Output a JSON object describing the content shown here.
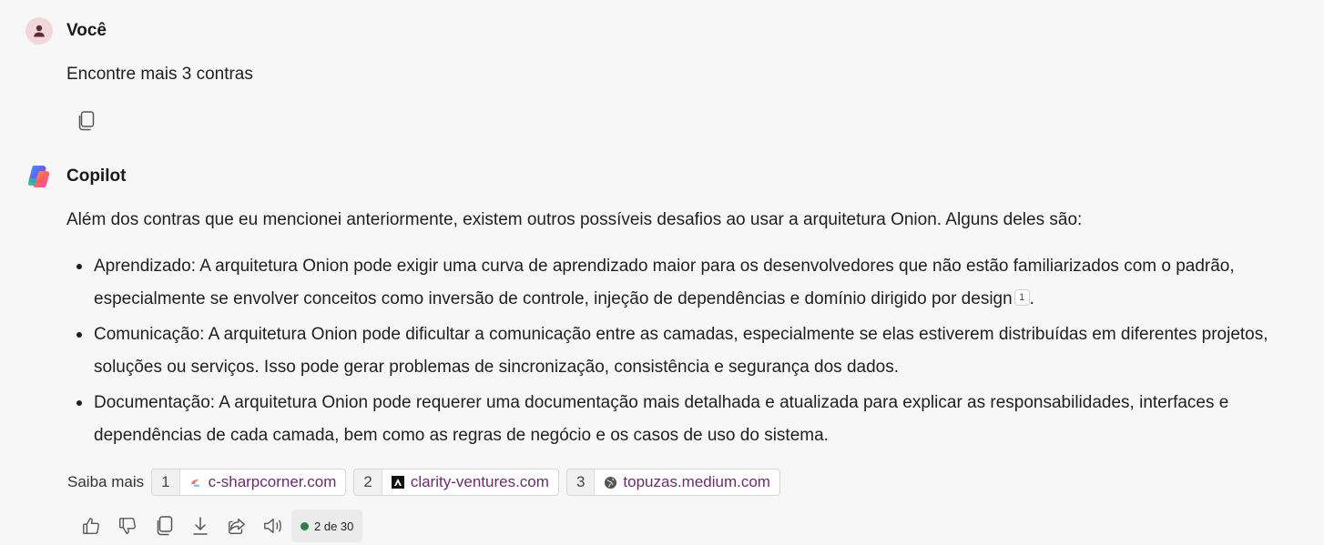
{
  "user_message": {
    "author": "Você",
    "text": "Encontre mais 3 contras"
  },
  "copilot_message": {
    "author": "Copilot",
    "intro": "Além dos contras que eu mencionei anteriormente, existem outros possíveis desafios ao usar a arquitetura Onion. Alguns deles são:",
    "bullets": [
      {
        "text": "Aprendizado: A arquitetura Onion pode exigir uma curva de aprendizado maior para os desenvolvedores que não estão familiarizados com o padrão, especialmente se envolver conceitos como inversão de controle, injeção de dependências e domínio dirigido por design",
        "citation": "1",
        "suffix": "."
      },
      {
        "text": "Comunicação: A arquitetura Onion pode dificultar a comunicação entre as camadas, especialmente se elas estiverem distribuídas em diferentes projetos, soluções ou serviços. Isso pode gerar problemas de sincronização, consistência e segurança dos dados."
      },
      {
        "text": "Documentação: A arquitetura Onion pode requerer uma documentação mais detalhada e atualizada para explicar as responsabilidades, interfaces e dependências de cada camada, bem como as regras de negócio e os casos de uso do sistema."
      }
    ],
    "learn_more_label": "Saiba mais",
    "sources": [
      {
        "num": "1",
        "domain": "c-sharpcorner.com",
        "icon": "c-sharpcorner-favicon"
      },
      {
        "num": "2",
        "domain": "clarity-ventures.com",
        "icon": "clarity-ventures-favicon"
      },
      {
        "num": "3",
        "domain": "topuzas.medium.com",
        "icon": "globe-icon"
      }
    ],
    "actions": [
      "thumbs-up-icon",
      "thumbs-down-icon",
      "copy-icon",
      "download-icon",
      "share-icon",
      "speaker-icon"
    ],
    "page_counter": "2 de 30",
    "counter_dot_color": "#2e7d4f"
  }
}
